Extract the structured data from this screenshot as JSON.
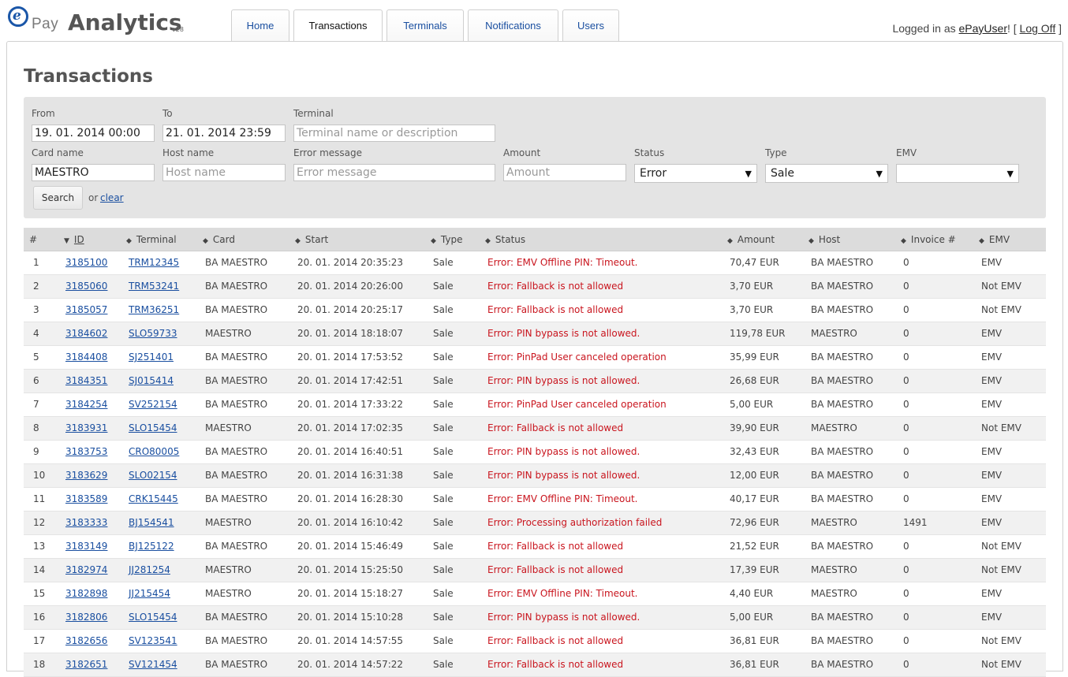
{
  "brand": {
    "logo_letter": "e",
    "logo_word": "Pay",
    "title": "Analytics",
    "version": "v28"
  },
  "nav": {
    "tabs": [
      {
        "label": "Home",
        "active": false
      },
      {
        "label": "Transactions",
        "active": true
      },
      {
        "label": "Terminals",
        "active": false
      },
      {
        "label": "Notifications",
        "active": false
      },
      {
        "label": "Users",
        "active": false
      }
    ]
  },
  "user": {
    "prefix": "Logged in as ",
    "name": "ePayUser",
    "suffix": "! [ ",
    "logoff": "Log Off",
    "close": " ]"
  },
  "page": {
    "title": "Transactions"
  },
  "filter": {
    "from_label": "From",
    "from_value": "19. 01. 2014 00:00",
    "to_label": "To",
    "to_value": "21. 01. 2014 23:59",
    "terminal_label": "Terminal",
    "terminal_placeholder": "Terminal name or description",
    "card_label": "Card name",
    "card_value": "MAESTRO",
    "host_label": "Host name",
    "host_placeholder": "Host name",
    "error_label": "Error message",
    "error_placeholder": "Error message",
    "amount_label": "Amount",
    "amount_placeholder": "Amount",
    "status_label": "Status",
    "status_value": "Error",
    "type_label": "Type",
    "type_value": "Sale",
    "emv_label": "EMV",
    "emv_value": "",
    "search_label": "Search",
    "or_label": "or",
    "clear_label": "clear"
  },
  "table": {
    "headers": [
      "#",
      "ID",
      "Terminal",
      "Card",
      "Start",
      "Type",
      "Status",
      "Amount",
      "Host",
      "Invoice #",
      "EMV"
    ],
    "rows": [
      [
        "1",
        "3185100",
        "TRM12345",
        "BA MAESTRO",
        "20. 01. 2014 20:35:23",
        "Sale",
        "Error: EMV Offline PIN: Timeout.",
        "70,47 EUR",
        "BA MAESTRO",
        "0",
        "EMV"
      ],
      [
        "2",
        "3185060",
        "TRM53241",
        "BA MAESTRO",
        "20. 01. 2014 20:26:00",
        "Sale",
        "Error: Fallback is not allowed",
        "3,70 EUR",
        "BA MAESTRO",
        "0",
        "Not EMV"
      ],
      [
        "3",
        "3185057",
        "TRM36251",
        "BA MAESTRO",
        "20. 01. 2014 20:25:17",
        "Sale",
        "Error: Fallback is not allowed",
        "3,70 EUR",
        "BA MAESTRO",
        "0",
        "Not EMV"
      ],
      [
        "4",
        "3184602",
        "SLO59733",
        "MAESTRO",
        "20. 01. 2014 18:18:07",
        "Sale",
        "Error: PIN bypass is not allowed.",
        "119,78 EUR",
        "MAESTRO",
        "0",
        "EMV"
      ],
      [
        "5",
        "3184408",
        "SJ251401",
        "BA MAESTRO",
        "20. 01. 2014 17:53:52",
        "Sale",
        "Error: PinPad User canceled operation",
        "35,99 EUR",
        "BA MAESTRO",
        "0",
        "EMV"
      ],
      [
        "6",
        "3184351",
        "SJ015414",
        "BA MAESTRO",
        "20. 01. 2014 17:42:51",
        "Sale",
        "Error: PIN bypass is not allowed.",
        "26,68 EUR",
        "BA MAESTRO",
        "0",
        "EMV"
      ],
      [
        "7",
        "3184254",
        "SV252154",
        "BA MAESTRO",
        "20. 01. 2014 17:33:22",
        "Sale",
        "Error: PinPad User canceled operation",
        "5,00 EUR",
        "BA MAESTRO",
        "0",
        "EMV"
      ],
      [
        "8",
        "3183931",
        "SLO15454",
        "MAESTRO",
        "20. 01. 2014 17:02:35",
        "Sale",
        "Error: Fallback is not allowed",
        "39,90 EUR",
        "MAESTRO",
        "0",
        "Not EMV"
      ],
      [
        "9",
        "3183753",
        "CRO80005",
        "BA MAESTRO",
        "20. 01. 2014 16:40:51",
        "Sale",
        "Error: PIN bypass is not allowed.",
        "32,43 EUR",
        "BA MAESTRO",
        "0",
        "EMV"
      ],
      [
        "10",
        "3183629",
        "SLO02154",
        "BA MAESTRO",
        "20. 01. 2014 16:31:38",
        "Sale",
        "Error: PIN bypass is not allowed.",
        "12,00 EUR",
        "BA MAESTRO",
        "0",
        "EMV"
      ],
      [
        "11",
        "3183589",
        "CRK15445",
        "BA MAESTRO",
        "20. 01. 2014 16:28:30",
        "Sale",
        "Error: EMV Offline PIN: Timeout.",
        "40,17 EUR",
        "BA MAESTRO",
        "0",
        "EMV"
      ],
      [
        "12",
        "3183333",
        "BJ154541",
        "MAESTRO",
        "20. 01. 2014 16:10:42",
        "Sale",
        "Error: Processing authorization failed",
        "72,96 EUR",
        "MAESTRO",
        "1491",
        "EMV"
      ],
      [
        "13",
        "3183149",
        "BJ125122",
        "BA MAESTRO",
        "20. 01. 2014 15:46:49",
        "Sale",
        "Error: Fallback is not allowed",
        "21,52 EUR",
        "BA MAESTRO",
        "0",
        "Not EMV"
      ],
      [
        "14",
        "3182974",
        "JJ281254",
        "MAESTRO",
        "20. 01. 2014 15:25:50",
        "Sale",
        "Error: Fallback is not allowed",
        "17,39 EUR",
        "MAESTRO",
        "0",
        "Not EMV"
      ],
      [
        "15",
        "3182898",
        "JJ215454",
        "MAESTRO",
        "20. 01. 2014 15:18:27",
        "Sale",
        "Error: EMV Offline PIN: Timeout.",
        "4,40 EUR",
        "MAESTRO",
        "0",
        "EMV"
      ],
      [
        "16",
        "3182806",
        "SLO15454",
        "BA MAESTRO",
        "20. 01. 2014 15:10:28",
        "Sale",
        "Error: PIN bypass is not allowed.",
        "5,00 EUR",
        "BA MAESTRO",
        "0",
        "EMV"
      ],
      [
        "17",
        "3182656",
        "SV123541",
        "BA MAESTRO",
        "20. 01. 2014 14:57:55",
        "Sale",
        "Error: Fallback is not allowed",
        "36,81 EUR",
        "BA MAESTRO",
        "0",
        "Not EMV"
      ],
      [
        "18",
        "3182651",
        "SV121454",
        "BA MAESTRO",
        "20. 01. 2014 14:57:22",
        "Sale",
        "Error: Fallback is not allowed",
        "36,81 EUR",
        "BA MAESTRO",
        "0",
        "Not EMV"
      ]
    ]
  },
  "colors": {
    "link": "#1a4fa0",
    "error": "#c9151e",
    "filter_bg": "#e4e4e4",
    "header_bg": "#dcdcdc",
    "row_alt": "#f1f1f1"
  }
}
